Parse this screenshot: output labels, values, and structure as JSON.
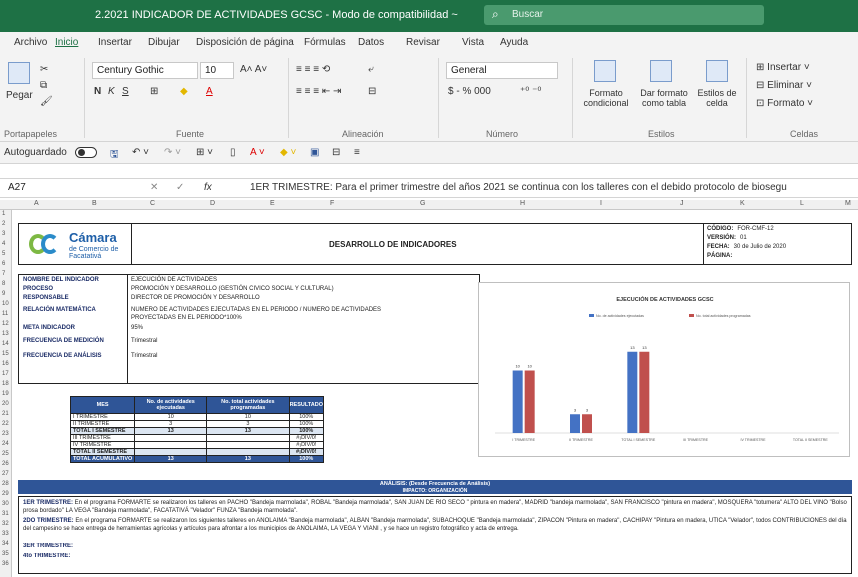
{
  "window": {
    "title": "2.2021 INDICADOR DE ACTIVIDADES GCSC  -  Modo de compatibilidad  ~",
    "search_placeholder": "Buscar"
  },
  "menu": {
    "tabs": [
      "Archivo",
      "Inicio",
      "Insertar",
      "Dibujar",
      "Disposición de página",
      "Fórmulas",
      "Datos",
      "Revisar",
      "Vista",
      "Ayuda"
    ],
    "active_index": 1
  },
  "ribbon": {
    "paste": "Pegar",
    "font_name": "Century Gothic",
    "font_size": "10",
    "number_format": "General",
    "currency": "$  -  %  000",
    "conditional_format": "Formato condicional",
    "format_table": "Dar formato como tabla",
    "cell_styles": "Estilos de celda",
    "insert": "Insertar",
    "delete": "Eliminar",
    "format": "Formato",
    "groups": [
      "Portapapeles",
      "Fuente",
      "Alineación",
      "Número",
      "Estilos",
      "Celdas"
    ]
  },
  "quick_access": {
    "autosave_label": "Autoguardado"
  },
  "formula_bar": {
    "cell_ref": "A27",
    "fx": "fx",
    "content": "1ER TRIMESTRE: Para el primer trimestre del años 2021 se continua con los talleres con el debido protocolo de biosegu"
  },
  "sheet": {
    "columns": [
      "A",
      "B",
      "C",
      "D",
      "E",
      "F",
      "G",
      "H",
      "I",
      "J",
      "K",
      "L",
      "M"
    ],
    "logo_title": "Cámara",
    "logo_sub": "de Comercio de Facatativá",
    "doc_title": "DESARROLLO DE INDICADORES",
    "meta": [
      {
        "k": "CÓDIGO:",
        "v": "FOR-CMF-12"
      },
      {
        "k": "VERSIÓN:",
        "v": "01"
      },
      {
        "k": "FECHA:",
        "v": "30 de Julio de 2020"
      },
      {
        "k": "PÁGINA:",
        "v": ""
      }
    ],
    "info": [
      {
        "k": "NOMBRE DEL INDICADOR",
        "v": "EJECUCIÓN DE ACTIVIDADES"
      },
      {
        "k": "PROCESO",
        "v": "PROMOCIÓN Y DESARROLLO (GESTIÓN CIVICO SOCIAL Y CULTURAL)"
      },
      {
        "k": "RESPONSABLE",
        "v": "DIRECTOR DE PROMOCIÓN Y DESARROLLO"
      },
      {
        "k": "RELACIÓN MATEMÁTICA",
        "v": "NUMERO DE ACTIVIDADES EJECUTADAS EN EL PERIODO / NUMERO DE ACTIVIDADES"
      },
      {
        "k": "",
        "v": "PROYECTADAS EN EL PERIODO*100%"
      },
      {
        "k": "META INDICADOR",
        "v": "95%"
      },
      {
        "k": "FRECUENCIA DE MEDICIÓN",
        "v": "Trimestral"
      },
      {
        "k": "FRECUENCIA DE ANÁLISIS",
        "v": "Trimestral"
      }
    ],
    "table": {
      "headers": [
        "MES",
        "No. de actividades ejecutadas",
        "No. total actividades programadas",
        "RESULTADO"
      ],
      "rows": [
        {
          "mes": "I TRIMESTRE",
          "a": "10",
          "b": "10",
          "r": "100%",
          "cls": ""
        },
        {
          "mes": "II TRIMESTRE",
          "a": "3",
          "b": "3",
          "r": "100%",
          "cls": ""
        },
        {
          "mes": "TOTAL I SEMESTRE",
          "a": "13",
          "b": "13",
          "r": "100%",
          "cls": "sub"
        },
        {
          "mes": "III TRIMESTRE",
          "a": "",
          "b": "",
          "r": "#¡DIV/0!",
          "cls": ""
        },
        {
          "mes": "IV TRIMESTRE",
          "a": "",
          "b": "",
          "r": "#¡DIV/0!",
          "cls": ""
        },
        {
          "mes": "TOTAL II SEMESTRE",
          "a": "",
          "b": "",
          "r": "#¡DIV/0!",
          "cls": "sub"
        },
        {
          "mes": "TOTAL ACUMULATIVO",
          "a": "13",
          "b": "13",
          "r": "100%",
          "cls": "acc"
        }
      ]
    },
    "analysis_title": "ANÁLISIS: (Desde Frecuencia de Análisis)",
    "impact_title": "IMPACTO: ORGANIZACIÓN",
    "notes": [
      {
        "bold": "1ER TRIMESTRE:",
        "text": " En el programa FORMARTE se realizaron los talleres en PACHO \"Bandeja marmolada\", ROBAL \"Bandeja marmolada\", SAN JUAN DE RIO SECO \" pintura en madera\", MADRID \"bandeja marmolada\", SAN FRANCISCO \"pintura en madera\", MOSQUERA \"totumera\" ALTO DEL VINO \"Bolso prosa bordado\" LA VEGA \"Bandeja marmolada\", FACATATIVÁ \"Velador\" FUNZA \"Bandeja marmolada\"."
      },
      {
        "bold": "2DO TRIMESTRE:",
        "text": " En el programa FORMARTE se realizaron los siguientes talleres en ANOLAIMA \"Bandeja marmolada\", ALBÁN \"Bandeja marmolada\", SUBACHOQUE \"Bandeja marmolada\", ZIPACÓN \"Pintura en madera\", CACHIPAY \"Pintura en madera, UTICA \"Velador\", todos CONTRIBUCIONES del día del campesino se hace entrega de herramientas agrícolas y artículos para afrontar a los municipios de ANOLAIMA, LA VEGA Y VIANI , y se hace un registro fotográfico y acta de entrega."
      },
      {
        "bold": "3ER TRIMESTRE:",
        "text": ""
      },
      {
        "bold": "4to TRIMESTRE:",
        "text": ""
      }
    ]
  },
  "chart_data": {
    "type": "bar",
    "title": "EJECUCIÓN DE ACTIVIDADES GCSC",
    "categories": [
      "I TRIMESTRE",
      "II TRIMESTRE",
      "TOTAL I SEMESTRE",
      "III TRIMESTRE",
      "IV TRIMESTRE",
      "TOTAL II SEMESTRE"
    ],
    "series": [
      {
        "name": "No. de actividades ejecutadas",
        "values": [
          10,
          3,
          13,
          null,
          null,
          null
        ],
        "color": "#4472c4"
      },
      {
        "name": "No. total actividades programadas",
        "values": [
          10,
          3,
          13,
          null,
          null,
          null
        ],
        "color": "#c0504d"
      }
    ],
    "ylim": [
      0,
      16
    ],
    "legend": "top",
    "grid": false
  }
}
